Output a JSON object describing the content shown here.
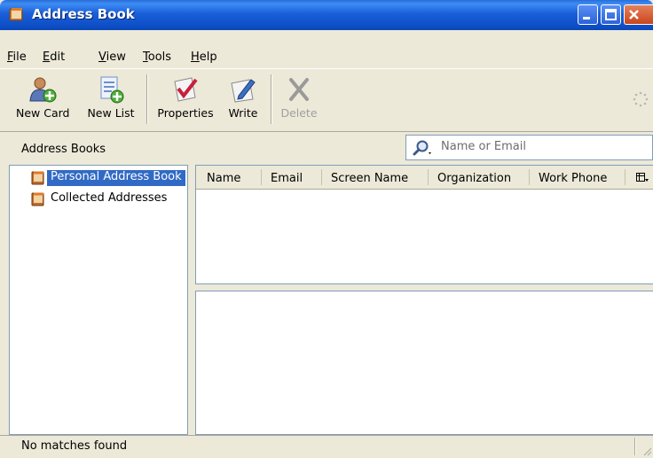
{
  "window": {
    "title": "Address Book"
  },
  "menu": [
    {
      "label": "File",
      "mnemonic": "F",
      "rest": "ile"
    },
    {
      "label": "Edit",
      "mnemonic": "E",
      "rest": "dit"
    },
    {
      "label": "View",
      "mnemonic": "V",
      "rest": "iew"
    },
    {
      "label": "Tools",
      "mnemonic": "T",
      "rest": "ools"
    },
    {
      "label": "Help",
      "mnemonic": "H",
      "rest": "elp"
    }
  ],
  "toolbar": {
    "new_card": "New Card",
    "new_list": "New List",
    "properties": "Properties",
    "write": "Write",
    "delete": "Delete"
  },
  "sidebar": {
    "heading": "Address Books",
    "items": [
      {
        "label": "Personal Address Book",
        "selected": true
      },
      {
        "label": "Collected Addresses",
        "selected": false
      }
    ]
  },
  "search": {
    "placeholder": "Name or Email"
  },
  "results": {
    "columns": [
      "Name",
      "Email",
      "Screen Name",
      "Organization",
      "Work Phone"
    ],
    "rows": []
  },
  "status": {
    "text": "No matches found"
  },
  "colors": {
    "titlebar": "#0e4fc7",
    "selection": "#316ac5",
    "chrome": "#ece9d8"
  },
  "icons": [
    "address-book-icon",
    "minimize-icon",
    "maximize-icon",
    "close-icon",
    "new-card-icon",
    "new-list-icon",
    "properties-icon",
    "write-icon",
    "delete-icon",
    "search-icon",
    "column-picker-icon",
    "throbber-icon",
    "book-icon"
  ]
}
